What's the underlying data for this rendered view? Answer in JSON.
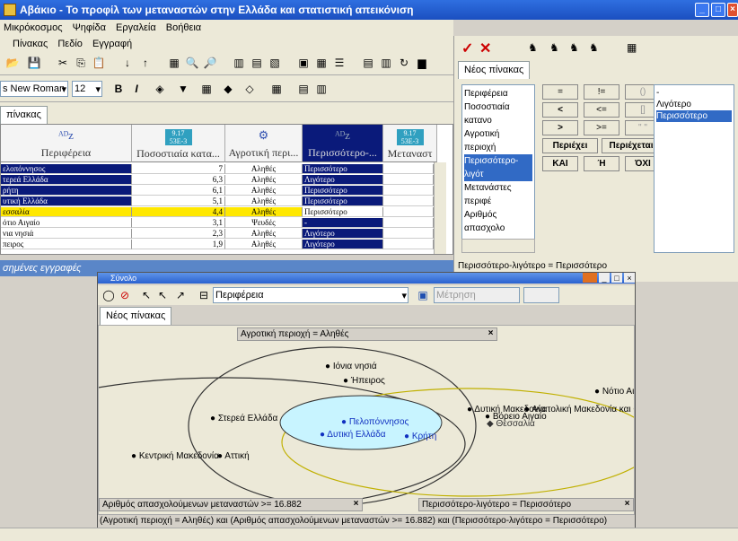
{
  "window": {
    "title": "Αβάκιο - Το προφίλ των μεταναστών στην Ελλάδα και στατιστική απεικόνιση"
  },
  "menu": {
    "items": [
      "Μικρόκοσμος",
      "Ψηφίδα",
      "Εργαλεία",
      "Βοήθεια"
    ]
  },
  "menu2": {
    "items": [
      "Πίνακας",
      "Πεδίο",
      "Εγγραφή"
    ]
  },
  "font": {
    "name": "s New Roman",
    "size": "12"
  },
  "table": {
    "tab": "πίνακας",
    "headers": [
      "Περιφέρεια",
      "Ποσοστιαία κατα...",
      "Αγροτική περι...",
      "Περισσότερο-...",
      "Μεταναστ"
    ],
    "rows": [
      {
        "region": "ελοπόννησος",
        "pct": "7",
        "agri": "Αληθές",
        "more": "Περισσότερο",
        "style": "sel"
      },
      {
        "region": "τερεά Ελλάδα",
        "pct": "6,3",
        "agri": "Αληθές",
        "more": "Λιγότερο",
        "style": "sel"
      },
      {
        "region": "ρήτη",
        "pct": "6,1",
        "agri": "Αληθές",
        "more": "Περισσότερο",
        "style": "sel"
      },
      {
        "region": "υτική Ελλάδα",
        "pct": "5,1",
        "agri": "Αληθές",
        "more": "Περισσότερο",
        "style": "sel"
      },
      {
        "region": "εσσαλία",
        "pct": "4,4",
        "agri": "Αληθές",
        "more": "Περισσότερο",
        "style": "cur"
      },
      {
        "region": "ότιο Αιγαίο",
        "pct": "3,1",
        "agri": "Ψευδές",
        "more": "-",
        "style": "plain"
      },
      {
        "region": "νια νησιά",
        "pct": "2,3",
        "agri": "Αληθές",
        "more": "Λιγότερο",
        "style": "plain"
      },
      {
        "region": "πειρος",
        "pct": "1,9",
        "agri": "Αληθές",
        "more": "Λιγότερο",
        "style": "plain"
      }
    ]
  },
  "status": {
    "text": "σημένες εγγραφές"
  },
  "query": {
    "tab": "Νέος πίνακας",
    "fields": [
      "Περιφέρεια",
      "Ποσοστιαία κατανο",
      "Αγροτική περιοχή",
      "Περισσότερο-λιγότ",
      "Μετανάστες περιφέ",
      "Αριθμός απασχολο"
    ],
    "values": [
      "-",
      "Λιγότερο",
      "Περισσότερο"
    ],
    "ops": [
      "=",
      "!=",
      "()",
      "<",
      "<=",
      "[]",
      ">",
      ">=",
      "\" \""
    ],
    "logic": [
      "Περιέχει",
      "Περιέχεται",
      "ΚΑΙ",
      "Ή",
      "ΌΧΙ"
    ],
    "expr": "Περισσότερο-λιγότερο = Περισσότερο"
  },
  "venn": {
    "title": "Σύνολο",
    "field": "Περιφέρεια",
    "measure": "Μέτρηση",
    "tab": "Νέος πίνακας",
    "set1": "Αγροτική περιοχή = Αληθές",
    "set2": "Αριθμός απασχολούμενων μεταναστών >= 16.882",
    "set3": "Περισσότερο-λιγότερο = Περισσότερο",
    "footer": "(Αγροτική περιοχή = Αληθές) και (Αριθμός απασχολούμενων μεταναστών >= 16.882) και (Περισσότερο-λιγότερο = Περισσότερο)",
    "points": {
      "ionia": "Ιόνια νησιά",
      "ipeiros": "Ήπειρος",
      "notio": "Νότιο Αι",
      "dytmak": "Δυτική Μακεδονία",
      "anmak": "Ανατολική Μακεδονία και Θ",
      "voreio": "Βόρειο Αιγαίο",
      "thess": "Θεσσαλία",
      "sterea": "Στερεά Ελλάδα",
      "pelop": "Πελοπόννησος",
      "dyell": "Δυτική Ελλάδα",
      "kriti": "Κρήτη",
      "kentmak": "Κεντρική Μακεδονία",
      "attiki": "Αττική"
    }
  },
  "colors": {
    "title": "#1b4fc0",
    "sel": "#0a1a7a",
    "cur": "#ffe800",
    "cyan": "#c8f4ff"
  }
}
